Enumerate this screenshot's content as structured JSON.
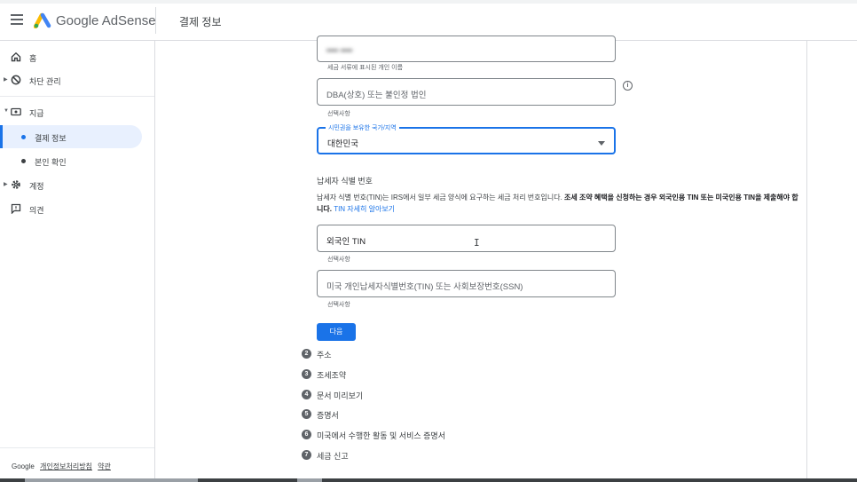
{
  "header": {
    "brand": "Google AdSense",
    "page_title": "결제 정보",
    "colors": {
      "accent": "#1a73e8",
      "logo_yellow": "#fbbc04",
      "logo_blue": "#4285f4",
      "logo_green": "#34a853"
    }
  },
  "sidebar": {
    "items": [
      {
        "label": "홈",
        "icon": "home-icon"
      },
      {
        "label": "차단 관리",
        "icon": "block-icon"
      },
      {
        "label": "지급",
        "icon": "payments-icon"
      },
      {
        "label": "결제 정보",
        "active": true
      },
      {
        "label": "본인 확인"
      },
      {
        "label": "계정",
        "icon": "gear-icon"
      },
      {
        "label": "의견",
        "icon": "feedback-icon"
      }
    ],
    "footer": {
      "brand": "Google",
      "privacy": "개인정보처리방침",
      "terms": "약관"
    }
  },
  "form": {
    "name_field": {
      "value": "•••• ••••",
      "helper": "세금 서류에 표시된 개인 이름"
    },
    "dba_field": {
      "placeholder": "DBA(상호) 또는 불인정 법인",
      "helper": "선택사항"
    },
    "country_field": {
      "label": "시민권을 보유한 국가/지역",
      "value": "대한민국"
    },
    "tin_section": {
      "title": "납세자 식별 번호",
      "desc_plain_1": "납세자 식별 번호(TIN)는 IRS에서 일부 세금 양식에 요구하는 세금 처리 번호입니다. ",
      "desc_bold": "조세 조약 혜택을 신청하는 경우 외국인용 TIN 또는 미국인용 TIN을 제출해야 합니다.",
      "desc_link": "TIN 자세히 알아보기"
    },
    "foreign_tin_field": {
      "placeholder": "외국인 TIN",
      "helper": "선택사항"
    },
    "us_tin_field": {
      "placeholder": "미국 개인납세자식별번호(TIN) 또는 사회보장번호(SSN)",
      "helper": "선택사항"
    },
    "next_button": "다음"
  },
  "steps": [
    {
      "num": "2",
      "label": "주소"
    },
    {
      "num": "3",
      "label": "조세조약"
    },
    {
      "num": "4",
      "label": "문서 미리보기"
    },
    {
      "num": "5",
      "label": "증명서"
    },
    {
      "num": "6",
      "label": "미국에서 수행한 활동 및 서비스 증명서"
    },
    {
      "num": "7",
      "label": "세금 신고"
    }
  ]
}
